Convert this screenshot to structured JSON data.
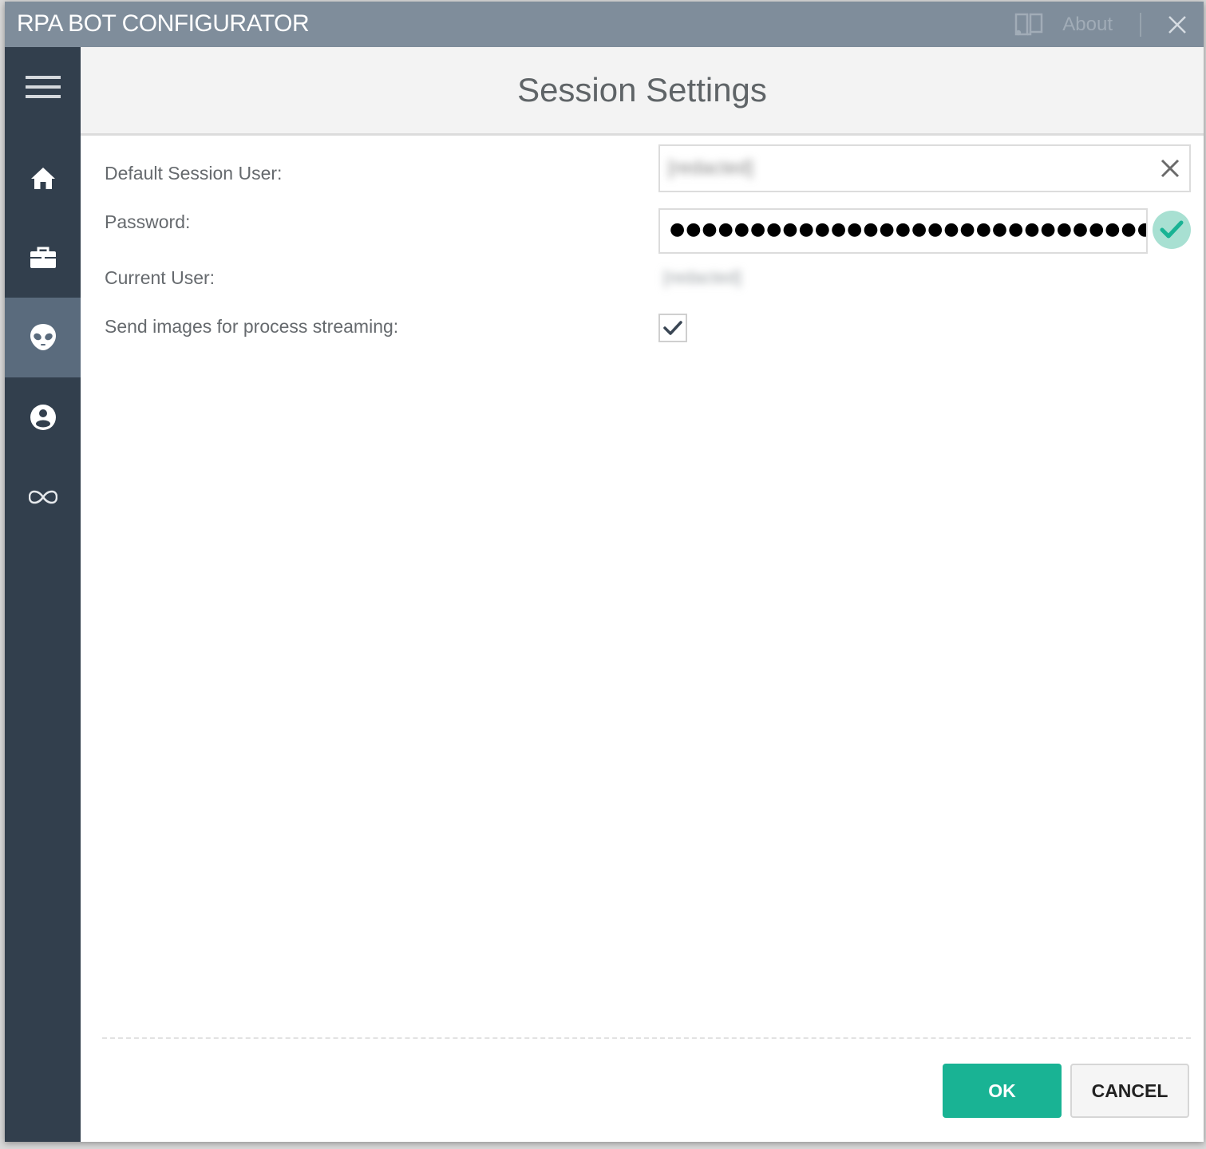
{
  "window": {
    "app_title": "RPA BOT CONFIGURATOR",
    "about_label": "About",
    "about_icon": "book-info-icon",
    "close_icon": "close-icon"
  },
  "sidebar": {
    "items": [
      {
        "name": "menu",
        "icon": "hamburger-menu-icon",
        "active": false
      },
      {
        "name": "home",
        "icon": "home-icon",
        "active": false
      },
      {
        "name": "jobs",
        "icon": "briefcase-icon",
        "active": false
      },
      {
        "name": "bot",
        "icon": "alien-icon",
        "active": true
      },
      {
        "name": "user",
        "icon": "user-circle-icon",
        "active": false
      },
      {
        "name": "loop",
        "icon": "infinity-icon",
        "active": false
      }
    ]
  },
  "page": {
    "title": "Session Settings",
    "fields": {
      "default_session_user": {
        "label": "Default Session User:",
        "value": "[redacted]"
      },
      "password": {
        "label": "Password:",
        "value": "●●●●●●●●●●●●●●●●●●●●●●●●●●●●●●●●●●●●●●●●●●●●●●●●",
        "validated": true
      },
      "current_user": {
        "label": "Current User:",
        "value": "[redacted]"
      },
      "send_images": {
        "label": "Send images for process streaming:",
        "checked": true
      }
    }
  },
  "footer": {
    "ok_label": "OK",
    "cancel_label": "CANCEL"
  },
  "colors": {
    "titlebar": "#7f8d9b",
    "sidebar": "#323f4d",
    "sidebar_active": "#5a6b7d",
    "accent": "#19b394",
    "valid_badge": "#a8e0d2"
  }
}
